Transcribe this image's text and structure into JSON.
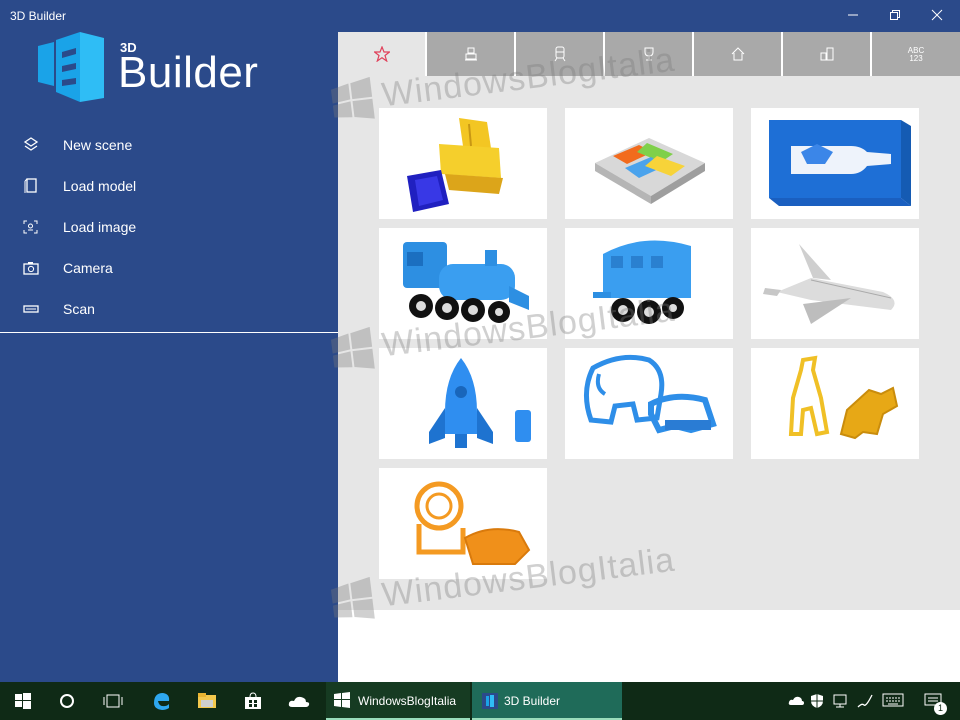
{
  "window": {
    "title": "3D Builder"
  },
  "logo": {
    "superscript": "3D",
    "name": "Builder"
  },
  "menu": {
    "items": [
      {
        "label": "New scene",
        "icon": "new-scene-icon"
      },
      {
        "label": "Load model",
        "icon": "load-model-icon"
      },
      {
        "label": "Load image",
        "icon": "load-image-icon"
      },
      {
        "label": "Camera",
        "icon": "camera-icon"
      },
      {
        "label": "Scan",
        "icon": "scan-icon"
      }
    ]
  },
  "tabs": [
    {
      "name": "favorites",
      "icon": "star-icon",
      "active": true
    },
    {
      "name": "robots",
      "icon": "robot-icon",
      "active": false
    },
    {
      "name": "vehicles",
      "icon": "train-icon",
      "active": false
    },
    {
      "name": "trophies",
      "icon": "trophy-icon",
      "active": false
    },
    {
      "name": "home",
      "icon": "house-icon",
      "active": false
    },
    {
      "name": "city",
      "icon": "buildings-icon",
      "active": false
    },
    {
      "name": "letters",
      "label_top": "ABC",
      "label_bottom": "123",
      "active": false
    }
  ],
  "models": [
    "bulldozer",
    "windows-logo-tray",
    "bottle-mold",
    "train-locomotive",
    "train-wagon",
    "space-shuttle",
    "rocket",
    "elephant-cookie-cutter",
    "giraffe-cookie-cutter",
    "lion-cookie-cutter"
  ],
  "watermark": "WindowsBlogItalia",
  "taskbar": {
    "apps": [
      {
        "label": "WindowsBlogItalia"
      },
      {
        "label": "3D Builder"
      }
    ],
    "notification_count": "1"
  },
  "colors": {
    "sidebar": "#2b4a8a",
    "taskbar": "#0f2a16",
    "tab_inactive": "#a9a9a9",
    "accent_star": "#e0405a"
  }
}
